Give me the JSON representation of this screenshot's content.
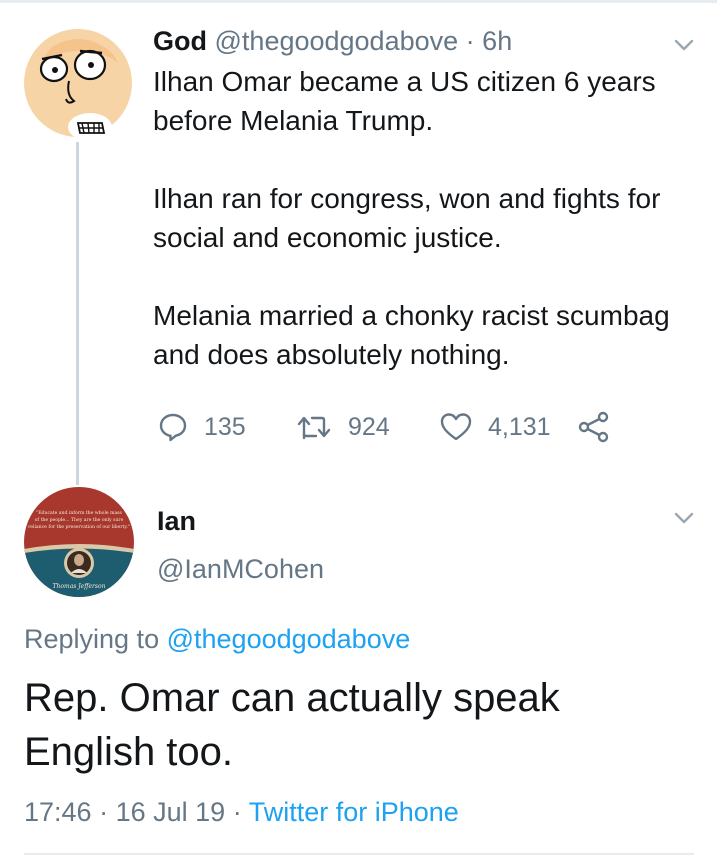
{
  "colors": {
    "text": "#14171a",
    "secondary": "#657786",
    "link": "#1da1f2",
    "divider": "#e6ecf0",
    "thread_line": "#ccd6dd"
  },
  "tweet1": {
    "author_name": "God",
    "author_handle": "@thegoodgodabove",
    "separator": "·",
    "time_ago": "6h",
    "menu_icon": "chevron-down-icon",
    "paragraphs": [
      "Ilhan Omar became a US citizen 6 years before Melania Trump.",
      "Ilhan ran for congress, won and fights for social and economic justice.",
      "Melania married a chonky racist scumbag and does absolutely nothing."
    ],
    "actions": {
      "reply": {
        "icon": "reply-icon",
        "count": "135"
      },
      "retweet": {
        "icon": "retweet-icon",
        "count": "924"
      },
      "like": {
        "icon": "heart-icon",
        "count": "4,131"
      },
      "share": {
        "icon": "share-icon"
      }
    }
  },
  "tweet2": {
    "author_name": "Ian",
    "author_handle": "@IanMCohen",
    "menu_icon": "chevron-down-icon",
    "replying_prefix": "Replying to",
    "replying_to": "@thegoodgodabove",
    "text": "Rep. Omar can actually speak English too.",
    "time": "17:46",
    "separator": "·",
    "date": "16 Jul 19",
    "source": "Twitter for iPhone",
    "avatar": {
      "quote": "\"Educate and inform the whole mass of the people... They are the only sure reliance for the preservation of our liberty.\"",
      "caption": "Thomas Jefferson"
    }
  }
}
